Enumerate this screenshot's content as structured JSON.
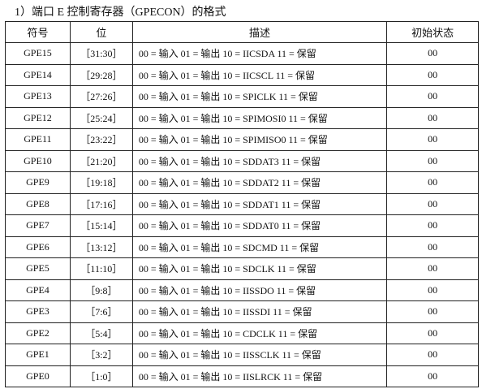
{
  "title": "1）端口 E 控制寄存器（GPECON）的格式",
  "headers": [
    "符号",
    "位",
    "描述",
    "初始状态"
  ],
  "rows": [
    [
      "GPE15",
      "［31:30］",
      "00 = 输入 01 = 输出 10 = IICSDA 11 = 保留",
      "00"
    ],
    [
      "GPE14",
      "［29:28］",
      "00 = 输入 01 = 输出 10 = IICSCL 11 = 保留",
      "00"
    ],
    [
      "GPE13",
      "［27:26］",
      "00 = 输入 01 = 输出 10 = SPICLK 11 = 保留",
      "00"
    ],
    [
      "GPE12",
      "［25:24］",
      "00 = 输入 01 = 输出 10 = SPIMOSI0 11 = 保留",
      "00"
    ],
    [
      "GPE11",
      "［23:22］",
      "00 = 输入 01 = 输出 10 = SPIMISO0 11 = 保留",
      "00"
    ],
    [
      "GPE10",
      "［21:20］",
      "00 = 输入 01 = 输出 10 = SDDAT3 11 = 保留",
      "00"
    ],
    [
      "GPE9",
      "［19:18］",
      "00 = 输入 01 = 输出 10 = SDDAT2 11 = 保留",
      "00"
    ],
    [
      "GPE8",
      "［17:16］",
      "00 = 输入 01 = 输出 10 = SDDAT1 11 = 保留",
      "00"
    ],
    [
      "GPE7",
      "［15:14］",
      "00 = 输入 01 = 输出 10 = SDDAT0 11 = 保留",
      "00"
    ],
    [
      "GPE6",
      "［13:12］",
      "00 = 输入 01 = 输出 10 = SDCMD 11 = 保留",
      "00"
    ],
    [
      "GPE5",
      "［11:10］",
      "00 = 输入 01 = 输出 10 = SDCLK 11 = 保留",
      "00"
    ],
    [
      "GPE4",
      "［9:8］",
      "00 = 输入 01 = 输出 10 = IISSDO 11 = 保留",
      "00"
    ],
    [
      "GPE3",
      "［7:6］",
      "00 = 输入 01 = 输出 10 = IISSDI 11 = 保留",
      "00"
    ],
    [
      "GPE2",
      "［5:4］",
      "00 = 输入 01 = 输出 10 = CDCLK 11 = 保留",
      "00"
    ],
    [
      "GPE1",
      "［3:2］",
      "00 = 输入 01 = 输出 10 = IISSCLK 11 = 保留",
      "00"
    ],
    [
      "GPE0",
      "［1:0］",
      "00 = 输入 01 = 输出 10 = IISLRCK 11 = 保留",
      "00"
    ]
  ]
}
